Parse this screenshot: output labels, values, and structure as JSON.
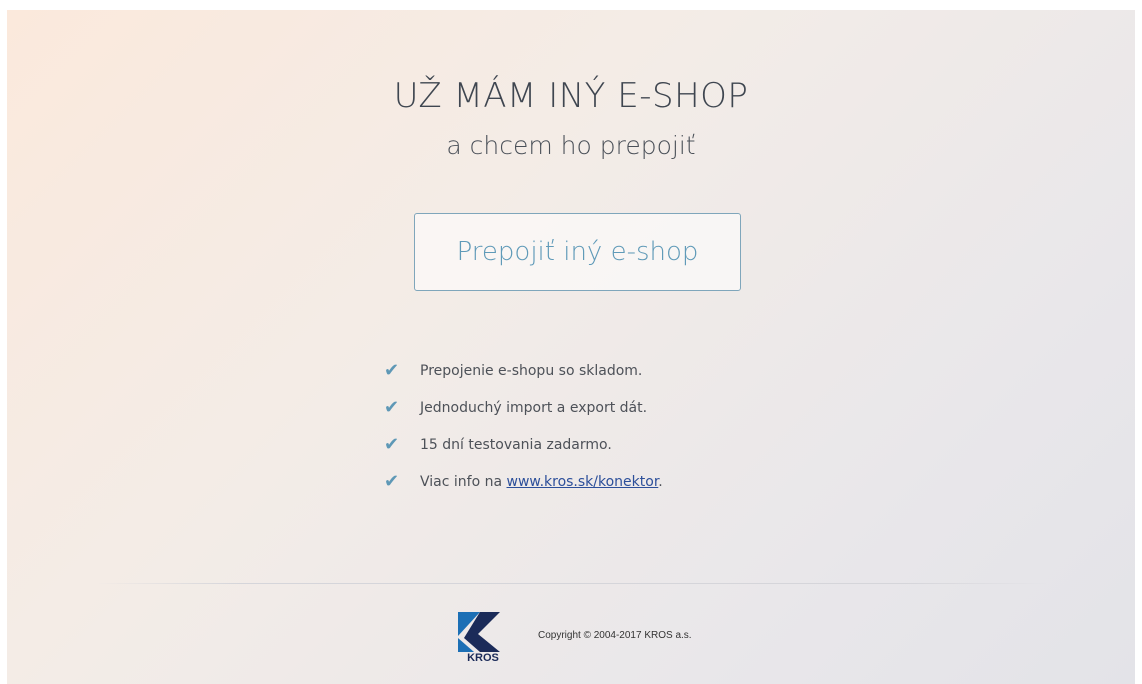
{
  "hero": {
    "title": "UŽ MÁM INÝ E-SHOP",
    "subtitle": "a chcem ho prepojiť"
  },
  "cta": {
    "label": "Prepojiť iný e-shop"
  },
  "features": {
    "icon": "check-icon",
    "items": [
      "Prepojenie e-shopu so skladom.",
      "Jednoduchý import a export dát.",
      "15 dní testovania zadarmo."
    ],
    "info_prefix": "Viac info na ",
    "info_link": "www.kros.sk/konektor",
    "info_suffix": "."
  },
  "footer": {
    "logo_text": "KROS",
    "copyright": "Copyright © 2004-2017 KROS a.s."
  },
  "colors": {
    "accent": "#5f9ab8",
    "link": "#2c4f9a",
    "logo_blue": "#1c6fb5",
    "logo_dark": "#1b2b59"
  }
}
